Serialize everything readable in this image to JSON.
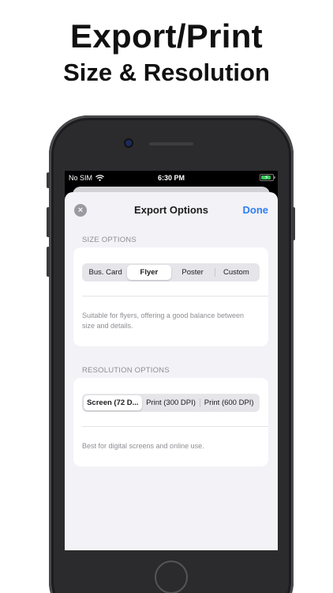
{
  "promo": {
    "title": "Export/Print",
    "subtitle": "Size & Resolution"
  },
  "status_bar": {
    "carrier": "No SIM",
    "time": "6:30 PM",
    "battery_level": 0.85,
    "charging": true,
    "icons": [
      "wifi-icon",
      "battery-icon",
      "charging-bolt-icon"
    ]
  },
  "sheet": {
    "title": "Export Options",
    "done_label": "Done",
    "close_glyph": "×"
  },
  "size_options": {
    "header": "SIZE OPTIONS",
    "segments": [
      "Bus. Card",
      "Flyer",
      "Poster",
      "Custom"
    ],
    "selected": "Flyer",
    "description": "Suitable for flyers, offering a good balance between size and details."
  },
  "resolution_options": {
    "header": "RESOLUTION OPTIONS",
    "segments": [
      "Screen (72 D...",
      "Print (300 DPI)",
      "Print (600 DPI)"
    ],
    "selected": "Screen (72 D...",
    "description": "Best for digital screens and online use."
  },
  "colors": {
    "accent": "#2f7df6",
    "sheet_background": "#f2f2f7",
    "card_background": "#ffffff",
    "secondary_text": "#8e8e93",
    "segment_track": "#e5e5ea"
  }
}
